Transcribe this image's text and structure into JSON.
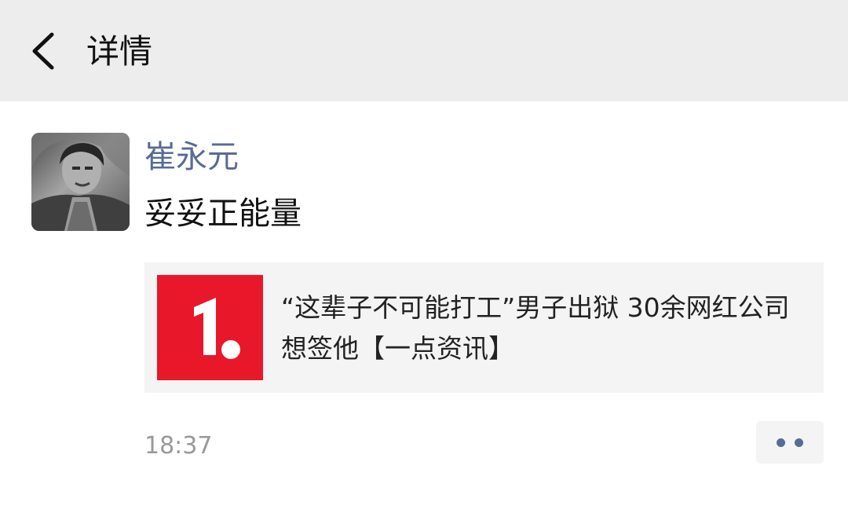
{
  "nav": {
    "back_icon": "chevron-left-icon",
    "title": "详情"
  },
  "post": {
    "avatar_icon": "user-photo",
    "author": "崔永元",
    "text": "妥妥正能量",
    "link_card": {
      "thumbnail_icon": "yidian-zixun-logo",
      "title": "“这辈子不可能打工”男子出狱 30余网红公司想签他【一点资讯】"
    },
    "time": "18:37",
    "more_icon": "more-dots-icon"
  },
  "colors": {
    "nav_background": "#ededed",
    "author_link": "#576b95",
    "card_background": "#f4f4f4",
    "logo_red": "#e8172a"
  }
}
